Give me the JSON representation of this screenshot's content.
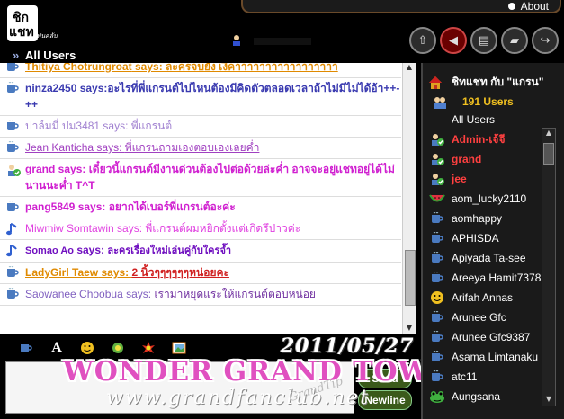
{
  "app": {
    "logo_text": "ชิกแชท",
    "logo_sub": "แฟนคลับ",
    "about": "About"
  },
  "tabs": {
    "all_users": "All Users"
  },
  "toolbar": {
    "icons": [
      "up-arrow-icon",
      "speaker-icon",
      "document-icon",
      "erase-icon",
      "exit-icon"
    ]
  },
  "messages": [
    {
      "name": "Thitiya Chotrungroat",
      "says": " says: ",
      "text": "ละครจบยัง เงิคาาาาาาาาาาาาาาาาา",
      "color": "#e08a00",
      "underline": true,
      "bold": true,
      "icon": "cup"
    },
    {
      "name": "ninza2450",
      "says": " says:",
      "text": "อะไรที่พี่แกรนต์ไปไหนต้องมีคิดตัวตลอดเวลาถ้าไม่มีไม่ได้อ้า++-++",
      "color": "#3a3ab0",
      "underline": false,
      "bold": true,
      "icon": "cup"
    },
    {
      "name": "ปาล์มมี่ ปม3481",
      "says": " says: ",
      "text": "พี่แกรนต์",
      "color": "#a080d0",
      "underline": false,
      "bold": false,
      "icon": "cup"
    },
    {
      "name": "Jean Kanticha",
      "says": " says: ",
      "text": "พี่แกรนถามเองตอบเองเลยค่ำ",
      "color": "#a040c0",
      "underline": true,
      "bold": false,
      "icon": "cup"
    },
    {
      "name": "grand",
      "says": " says: ",
      "text": "เดี๋ยวนี้แกรนต์มีงานด่วนต้องไปต่อด้วยล่ะค่ำ อาจจะอยู่แชทอยู่ได้ไม่นานนะค่ำ T^T",
      "color": "#d020d0",
      "underline": false,
      "bold": true,
      "icon": "admin"
    },
    {
      "name": "pang5849",
      "says": " says: ",
      "text": "อยากได้เบอร์พี่แกรนต์อะค่ะ",
      "color": "#d020d0",
      "underline": false,
      "bold": true,
      "icon": "cup"
    },
    {
      "name": "Miwmiw Somtawin",
      "says": " says: ",
      "text": "พี่แกรนต์ผมหยิกตั้งแต่เกิดรึป่าวค่ะ",
      "color": "#e040e0",
      "underline": false,
      "bold": false,
      "icon": "note"
    },
    {
      "name": "Somao Ao",
      "says": " says: ",
      "text": "ละครเรื่องใหม่เล่นคู่กับใครจ๊ำ",
      "color": "#7010c0",
      "underline": false,
      "bold": true,
      "icon": "note",
      "small": true
    },
    {
      "name": "LadyGirl Taew",
      "says": " says: ",
      "text": "2 นิ้วๆๆๆๆๆๆหน่อยคะ",
      "color": "#e08a00",
      "textcolor": "#d02020",
      "underline": true,
      "bold": true,
      "icon": "cup"
    },
    {
      "name": "Saowanee Choobua",
      "says": " says: ",
      "text": "เรามาหยุดแระให้แกรนต์ตอบหน่อย",
      "color": "#8060c0",
      "textcolor": "#7030a0",
      "underline": false,
      "bold": false,
      "icon": "cup"
    }
  ],
  "format_bar": {
    "icons": [
      "cup-icon",
      "font-icon",
      "smiley-icon",
      "emoticon-icon",
      "explosion-icon",
      "picture-icon"
    ],
    "date": "2011/05/27"
  },
  "input": {
    "send": "Send",
    "newline": "Newline"
  },
  "watermark": {
    "line1": "WONDER GRAND TOWN",
    "line2": "www.grandfanclub.net",
    "line3": "GrandTip"
  },
  "user_panel": {
    "title": "ชิทแชท กับ \"แกรน\"",
    "count": "191 Users",
    "all": "All Users",
    "users": [
      {
        "name": "Admin-เจ้จี",
        "role": "admin",
        "icon": "admin"
      },
      {
        "name": "grand",
        "role": "admin",
        "icon": "admin"
      },
      {
        "name": "jee",
        "role": "admin",
        "icon": "admin"
      },
      {
        "name": "aom_lucky2110",
        "role": "normal",
        "icon": "watermelon"
      },
      {
        "name": "aomhappy",
        "role": "normal",
        "icon": "cup"
      },
      {
        "name": "APHISDA",
        "role": "normal",
        "icon": "cup"
      },
      {
        "name": "Apiyada Ta-see",
        "role": "normal",
        "icon": "cup"
      },
      {
        "name": "Areeya Hamit7378",
        "role": "normal",
        "icon": "cup"
      },
      {
        "name": "Arifah Annas",
        "role": "normal",
        "icon": "smiley"
      },
      {
        "name": "Arunee Gfc",
        "role": "normal",
        "icon": "cup"
      },
      {
        "name": "Arunee Gfc9387",
        "role": "normal",
        "icon": "cup"
      },
      {
        "name": "Asama Limtanaku",
        "role": "normal",
        "icon": "cup"
      },
      {
        "name": "atc11",
        "role": "normal",
        "icon": "cup"
      },
      {
        "name": "Aungsana",
        "role": "normal",
        "icon": "frog"
      }
    ]
  }
}
